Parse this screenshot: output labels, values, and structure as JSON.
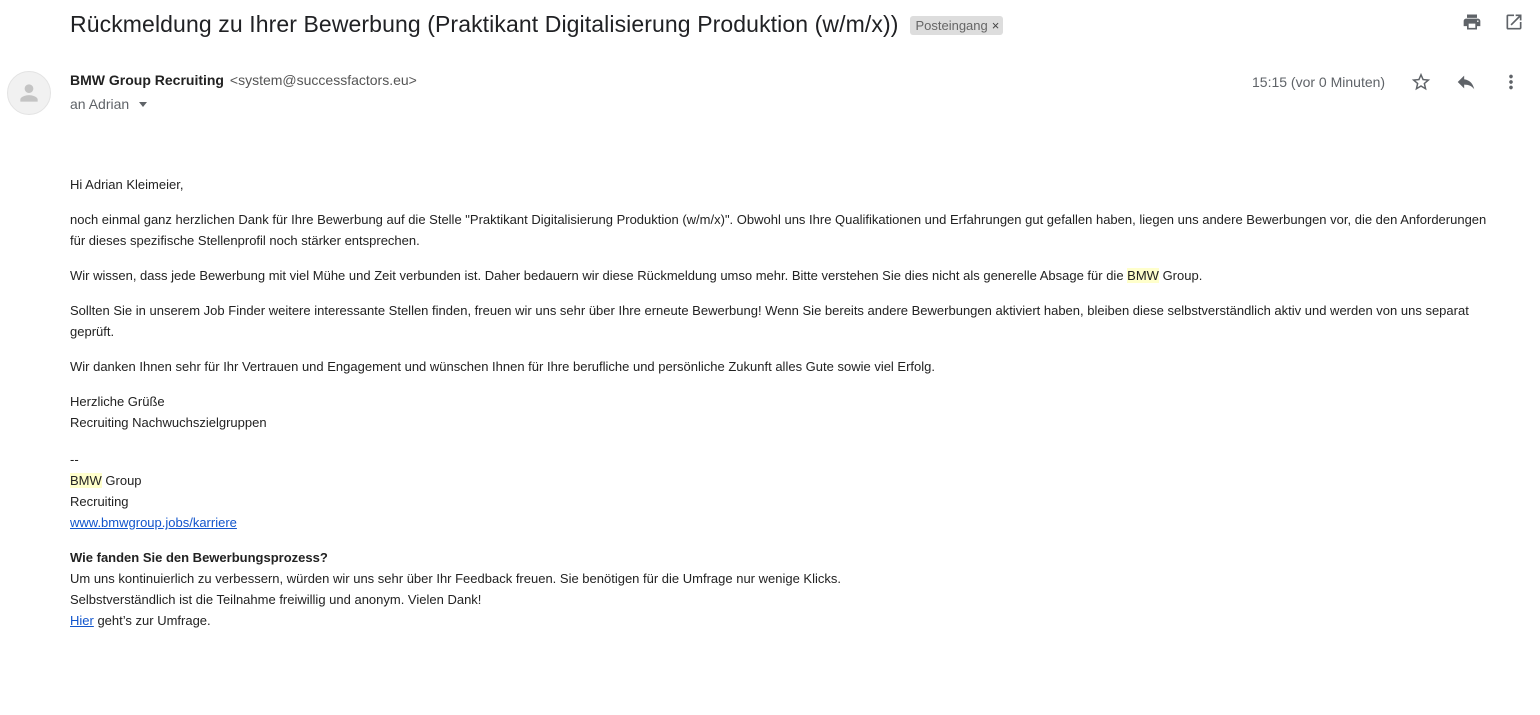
{
  "subject": {
    "title": "Rückmeldung zu Ihrer Bewerbung (Praktikant Digitalisierung Produktion (w/m/x))",
    "label": "Posteingang",
    "label_close": "×"
  },
  "icons": {
    "print": "print-icon",
    "open_new_window": "open-in-new-window-icon",
    "avatar": "person-avatar-icon",
    "star": "star-icon",
    "reply": "reply-icon",
    "more": "more-vert-icon"
  },
  "header": {
    "sender_name": "BMW Group Recruiting",
    "sender_email": "<system@successfactors.eu>",
    "recipient": "an Adrian",
    "time": "15:15 (vor 0 Minuten)"
  },
  "body": {
    "greeting": "Hi Adrian Kleimeier,",
    "para1": "noch einmal ganz herzlichen Dank für Ihre Bewerbung auf die Stelle \"Praktikant Digitalisierung Produktion (w/m/x)\". Obwohl uns Ihre Qualifikationen und Erfahrungen gut gefallen haben, liegen uns andere Bewerbungen vor, die den Anforderungen für dieses spezifische Stellenprofil noch stärker entsprechen.",
    "para2_before": "Wir wissen, dass jede Bewerbung mit viel Mühe und Zeit verbunden ist. Daher bedauern wir diese Rückmeldung umso mehr. Bitte verstehen Sie dies nicht als generelle Absage für die ",
    "para2_highlight": "BMW",
    "para2_after": " Group.",
    "para3": "Sollten Sie in unserem Job Finder weitere interessante Stellen finden, freuen wir uns sehr über Ihre erneute Bewerbung! Wenn Sie bereits andere Bewerbungen aktiviert haben, bleiben diese selbstverständlich aktiv und werden von uns separat geprüft.",
    "para4": "Wir danken Ihnen sehr für Ihr Vertrauen und Engagement und wünschen Ihnen für Ihre berufliche und persönliche Zukunft alles Gute sowie viel Erfolg.",
    "closing": "Herzliche Grüße",
    "team": "Recruiting Nachwuchszielgruppen",
    "sig_dash": "--",
    "sig_highlight": "BMW",
    "sig_group": " Group",
    "sig_recruiting": "Recruiting",
    "sig_link": "www.bmwgroup.jobs/karriere",
    "survey_title": "Wie fanden Sie den Bewerbungsprozess?",
    "survey_line1": "Um uns kontinuierlich zu verbessern, würden wir uns sehr über Ihr Feedback freuen. Sie benötigen für die Umfrage nur wenige Klicks.",
    "survey_line2": "Selbstverständlich ist die Teilnahme freiwillig und anonym. Vielen Dank!",
    "survey_link": "Hier",
    "survey_after": " geht’s zur Umfrage."
  }
}
